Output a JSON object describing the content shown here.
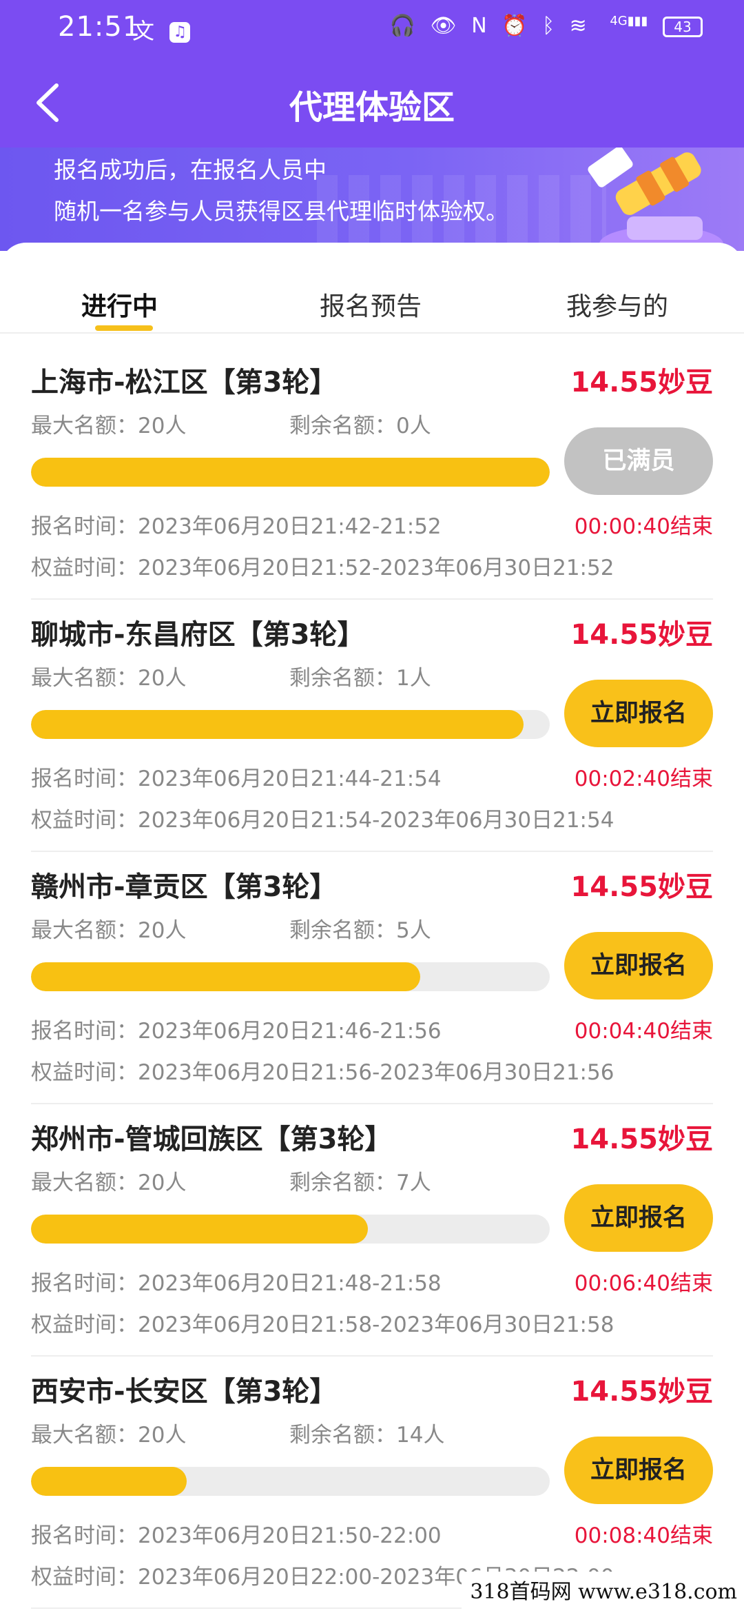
{
  "status_bar": {
    "time": "21:51",
    "left_glyph": "文",
    "battery": "43",
    "signal_label": "4G"
  },
  "header": {
    "title": "代理体验区"
  },
  "banner": {
    "line1": "报名成功后，在报名人员中",
    "line2": "随机一名参与人员获得区县代理临时体验权。"
  },
  "tabs": [
    {
      "label": "进行中",
      "active": true
    },
    {
      "label": "报名预告",
      "active": false
    },
    {
      "label": "我参与的",
      "active": false
    }
  ],
  "items": [
    {
      "title": "上海市-松江区【第3轮】",
      "price": "14.55妙豆",
      "max_quota": "最大名额：20人",
      "remaining": "剩余名额：0人",
      "fill_percent": 100,
      "button": "已满员",
      "button_disabled": true,
      "signup_time": "报名时间：2023年06月20日21:42-21:52",
      "countdown": "00:00:40结束",
      "benefit_time": "权益时间：2023年06月20日21:52-2023年06月30日21:52"
    },
    {
      "title": "聊城市-东昌府区【第3轮】",
      "price": "14.55妙豆",
      "max_quota": "最大名额：20人",
      "remaining": "剩余名额：1人",
      "fill_percent": 95,
      "button": "立即报名",
      "button_disabled": false,
      "signup_time": "报名时间：2023年06月20日21:44-21:54",
      "countdown": "00:02:40结束",
      "benefit_time": "权益时间：2023年06月20日21:54-2023年06月30日21:54"
    },
    {
      "title": "赣州市-章贡区【第3轮】",
      "price": "14.55妙豆",
      "max_quota": "最大名额：20人",
      "remaining": "剩余名额：5人",
      "fill_percent": 75,
      "button": "立即报名",
      "button_disabled": false,
      "signup_time": "报名时间：2023年06月20日21:46-21:56",
      "countdown": "00:04:40结束",
      "benefit_time": "权益时间：2023年06月20日21:56-2023年06月30日21:56"
    },
    {
      "title": "郑州市-管城回族区【第3轮】",
      "price": "14.55妙豆",
      "max_quota": "最大名额：20人",
      "remaining": "剩余名额：7人",
      "fill_percent": 65,
      "button": "立即报名",
      "button_disabled": false,
      "signup_time": "报名时间：2023年06月20日21:48-21:58",
      "countdown": "00:06:40结束",
      "benefit_time": "权益时间：2023年06月20日21:58-2023年06月30日21:58"
    },
    {
      "title": "西安市-长安区【第3轮】",
      "price": "14.55妙豆",
      "max_quota": "最大名额：20人",
      "remaining": "剩余名额：14人",
      "fill_percent": 30,
      "button": "立即报名",
      "button_disabled": false,
      "signup_time": "报名时间：2023年06月20日21:50-22:00",
      "countdown": "00:08:40结束",
      "benefit_time": "权益时间：2023年06月20日22:00-2023年06月30日22:00"
    }
  ],
  "watermark": "318首码网 www.e318.com",
  "colors": {
    "header_purple": "#7b4cf2",
    "accent_yellow": "#f9c11a",
    "price_red": "#e8153a",
    "disabled_gray": "#c2c2c2"
  }
}
